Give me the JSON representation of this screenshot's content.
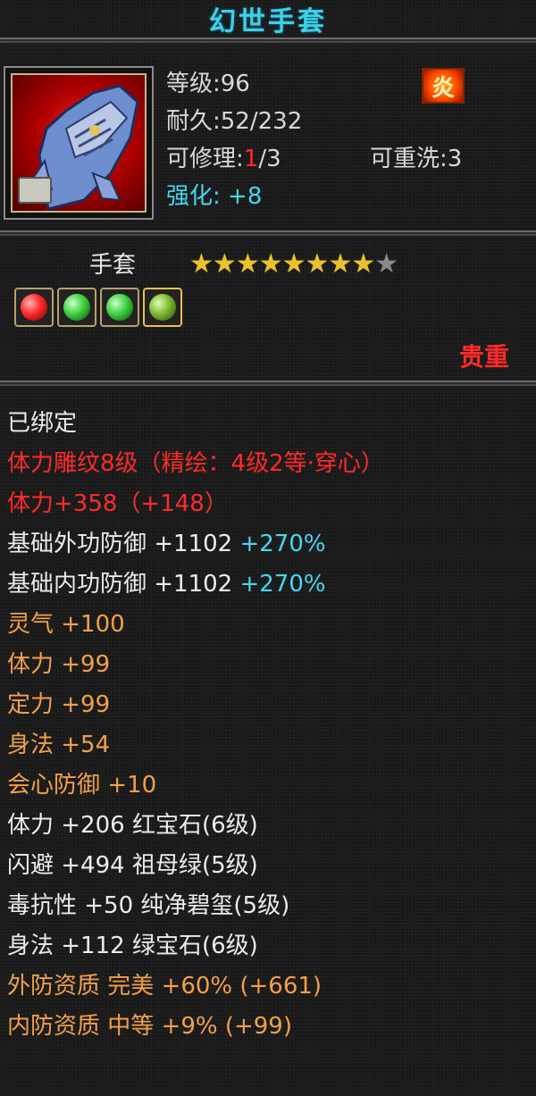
{
  "item": {
    "name": "幻世手套",
    "level_label": "等级:",
    "level": "96",
    "durability_label": "耐久:",
    "durability": "52/232",
    "repair_label": "可修理:",
    "repair_used": "1",
    "repair_total": "/3",
    "rewash_label": "可重洗:",
    "rewash": "3",
    "enhance_label": "强化:",
    "enhance": "+8",
    "quality_icon": "fire-quality-icon",
    "type": "手套",
    "stars_filled": 8,
    "stars_total": 9,
    "gems": [
      {
        "name": "red-gem",
        "color": "#ff2a2a"
      },
      {
        "name": "green-gem",
        "color": "#3fd03f"
      },
      {
        "name": "green-gem",
        "color": "#3fd03f"
      },
      {
        "name": "emerald-gem",
        "color": "#7ab830"
      }
    ],
    "rarity": "贵重"
  },
  "attributes": [
    {
      "text": "已绑定",
      "color": "white"
    },
    {
      "text": "体力雕纹8级（精绘：4级2等·穿心）",
      "color": "red"
    },
    {
      "text": "体力+358（+148）",
      "color": "red"
    },
    {
      "text": "基础外功防御 +1102",
      "extra": " +270%",
      "color": "white"
    },
    {
      "text": "基础内功防御 +1102",
      "extra": " +270%",
      "color": "white"
    },
    {
      "text": "灵气 +100",
      "color": "orange"
    },
    {
      "text": "体力 +99",
      "color": "orange"
    },
    {
      "text": "定力 +99",
      "color": "orange"
    },
    {
      "text": "身法 +54",
      "color": "orange"
    },
    {
      "text": "会心防御 +10",
      "color": "orange"
    },
    {
      "text": "体力 +206 红宝石(6级)",
      "color": "white"
    },
    {
      "text": "闪避 +494 祖母绿(5级)",
      "color": "white"
    },
    {
      "text": "毒抗性 +50 纯净碧玺(5级)",
      "color": "white"
    },
    {
      "text": "身法 +112 绿宝石(6级)",
      "color": "white"
    },
    {
      "text": "外防资质  完美 +60% (+661)",
      "color": "orange"
    },
    {
      "text": "内防资质  中等 +9% (+99)",
      "color": "orange"
    }
  ]
}
